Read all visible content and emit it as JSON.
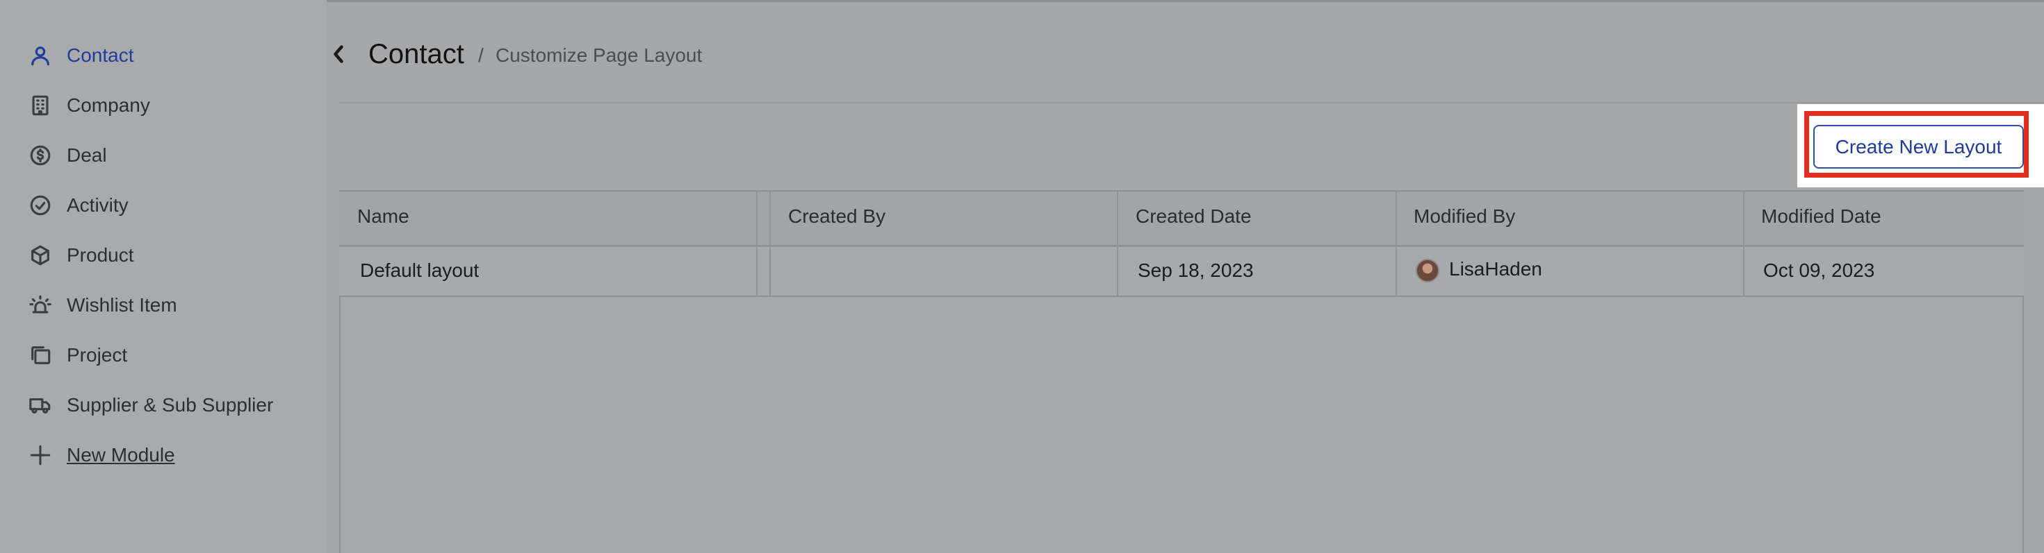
{
  "sidebar": {
    "items": [
      {
        "label": "Contact",
        "icon": "user-icon"
      },
      {
        "label": "Company",
        "icon": "building-icon"
      },
      {
        "label": "Deal",
        "icon": "dollar-circle-icon"
      },
      {
        "label": "Activity",
        "icon": "check-circle-icon"
      },
      {
        "label": "Product",
        "icon": "box-icon"
      },
      {
        "label": "Wishlist Item",
        "icon": "siren-icon"
      },
      {
        "label": "Project",
        "icon": "folders-icon"
      },
      {
        "label": "Supplier & Sub Supplier",
        "icon": "truck-icon"
      },
      {
        "label": "New Module",
        "icon": "plus-icon"
      }
    ]
  },
  "header": {
    "title": "Contact",
    "separator": "/",
    "breadcrumb": "Customize Page Layout"
  },
  "toolbar": {
    "create_label": "Create New Layout"
  },
  "table": {
    "columns": [
      "Name",
      "Created By",
      "Created Date",
      "Modified By",
      "Modified Date"
    ],
    "rows": [
      {
        "name": "Default layout",
        "created_by": "",
        "created_date": "Sep 18, 2023",
        "modified_by": "LisaHaden",
        "modified_date": "Oct 09, 2023"
      }
    ]
  },
  "colors": {
    "accent": "#1c3f9c",
    "highlight": "#e32b20",
    "overlay": "#a6a7a9"
  }
}
